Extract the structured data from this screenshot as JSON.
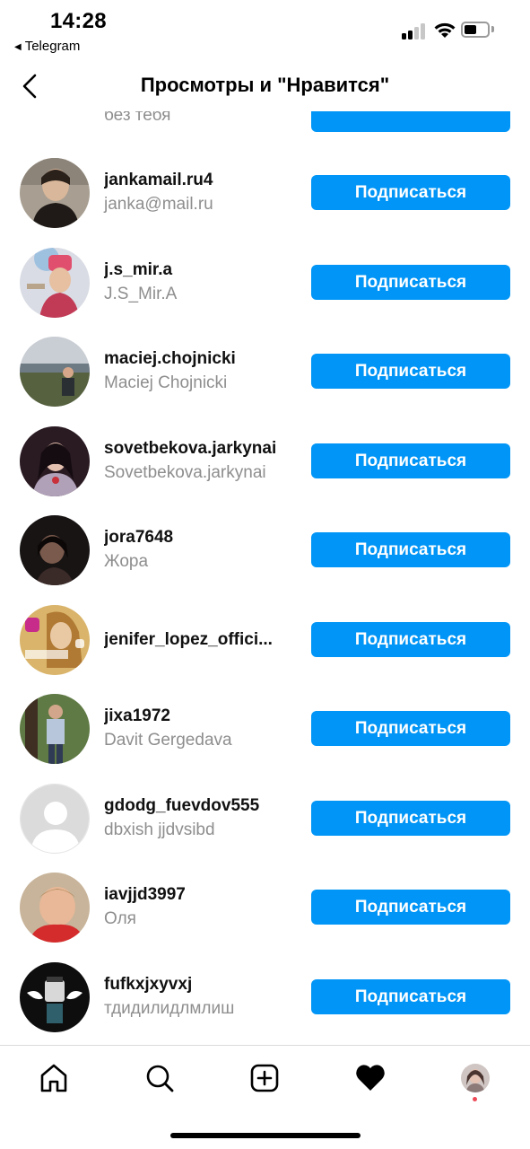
{
  "status_bar": {
    "time": "14:28",
    "back_app": "Telegram",
    "back_arrow_icon": "small-left-triangle-icon",
    "icons": [
      "cellular-signal-icon",
      "wifi-icon",
      "battery-icon"
    ],
    "battery_level": 0.55
  },
  "nav": {
    "title": "Просмотры и \"Нравится\"",
    "back_icon": "chevron-left-icon"
  },
  "colors": {
    "accent": "#0095f6",
    "secondary_text": "#8e8e8e",
    "notification_dot": "#ed4956"
  },
  "list": {
    "partial_top": {
      "fullname": "без тебя",
      "button": ""
    },
    "rows": [
      {
        "username": "jankamail.ru4",
        "fullname": "janka@mail.ru",
        "button": "Подписаться"
      },
      {
        "username": "j.s_mir.a",
        "fullname": "J.S_Mir.A",
        "button": "Подписаться"
      },
      {
        "username": "maciej.chojnicki",
        "fullname": "Maciej Chojnicki",
        "button": "Подписаться"
      },
      {
        "username": "sovetbekova.jarkynai",
        "fullname": "Sovetbekova.jarkynai",
        "button": "Подписаться"
      },
      {
        "username": "jora7648",
        "fullname": "Жора",
        "button": "Подписаться"
      },
      {
        "username": "jenifer_lopez_offici...",
        "fullname": "",
        "button": "Подписаться"
      },
      {
        "username": "jixa1972",
        "fullname": "Davit Gergedava",
        "button": "Подписаться"
      },
      {
        "username": "gdodg_fuevdov555",
        "fullname": "dbxish jjdvsibd",
        "button": "Подписаться"
      },
      {
        "username": "iavjjd3997",
        "fullname": "Оля",
        "button": "Подписаться"
      },
      {
        "username": "fufkxjxyvxj",
        "fullname": "тдидилидлмлиш",
        "button": "Подписаться"
      }
    ]
  },
  "tab_bar": {
    "tabs": [
      "home-icon",
      "search-icon",
      "new-post-icon",
      "activity-heart-icon",
      "profile-avatar"
    ],
    "active": "activity-heart-icon"
  }
}
